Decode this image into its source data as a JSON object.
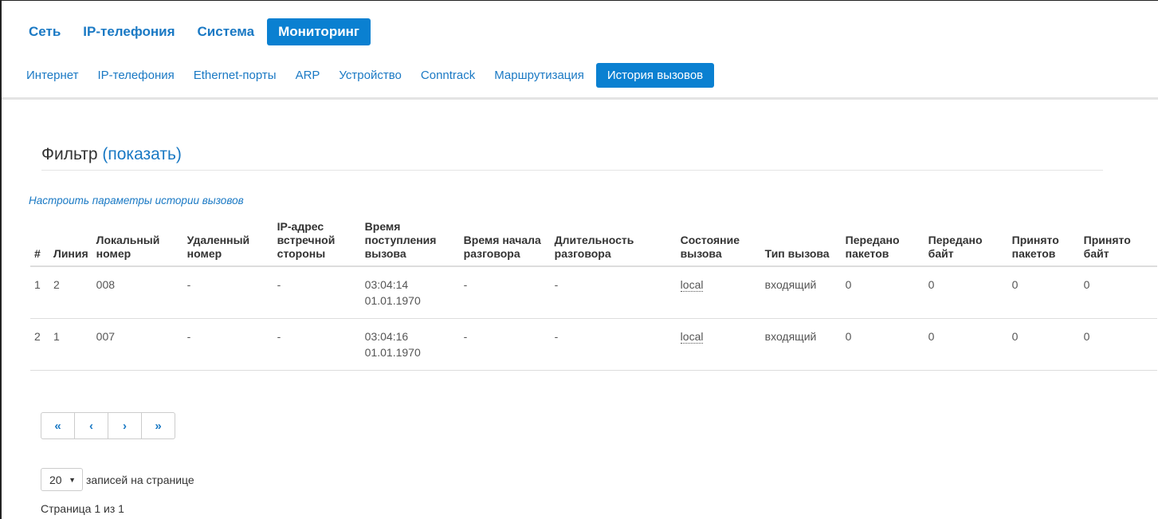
{
  "top_tabs": [
    {
      "label": "Сеть",
      "active": false
    },
    {
      "label": "IP-телефония",
      "active": false
    },
    {
      "label": "Система",
      "active": false
    },
    {
      "label": "Мониторинг",
      "active": true
    }
  ],
  "sub_tabs": [
    {
      "label": "Интернет",
      "active": false
    },
    {
      "label": "IP-телефония",
      "active": false
    },
    {
      "label": "Ethernet-порты",
      "active": false
    },
    {
      "label": "ARP",
      "active": false
    },
    {
      "label": "Устройство",
      "active": false
    },
    {
      "label": "Conntrack",
      "active": false
    },
    {
      "label": "Маршрутизация",
      "active": false
    },
    {
      "label": "История вызовов",
      "active": true
    }
  ],
  "filter": {
    "title": "Фильтр",
    "toggle": "(показать)"
  },
  "settings_link": "Настроить параметры истории вызовов",
  "table": {
    "headers": [
      "#",
      "Линия",
      "Локальный номер",
      "Удаленный номер",
      "IP-адрес встречной стороны",
      "Время поступления вызова",
      "Время начала разговора",
      "Длительность разговора",
      "Состояние вызова",
      "Тип вызова",
      "Передано пакетов",
      "Передано байт",
      "Принято пакетов",
      "Принято байт"
    ],
    "rows": [
      {
        "num": "1",
        "line": "2",
        "local": "008",
        "remote": "-",
        "ip": "-",
        "time_in": "03:04:14",
        "date_in": "01.01.1970",
        "start": "-",
        "duration": "-",
        "state": "local",
        "type": "входящий",
        "sent_pkts": "0",
        "sent_bytes": "0",
        "recv_pkts": "0",
        "recv_bytes": "0"
      },
      {
        "num": "2",
        "line": "1",
        "local": "007",
        "remote": "-",
        "ip": "-",
        "time_in": "03:04:16",
        "date_in": "01.01.1970",
        "start": "-",
        "duration": "-",
        "state": "local",
        "type": "входящий",
        "sent_pkts": "0",
        "sent_bytes": "0",
        "recv_pkts": "0",
        "recv_bytes": "0"
      }
    ]
  },
  "pager": {
    "first": "«",
    "prev": "‹",
    "next": "›",
    "last": "»"
  },
  "per_page": {
    "value": "20",
    "label": "записей на странице"
  },
  "page_info": "Страница 1 из 1"
}
